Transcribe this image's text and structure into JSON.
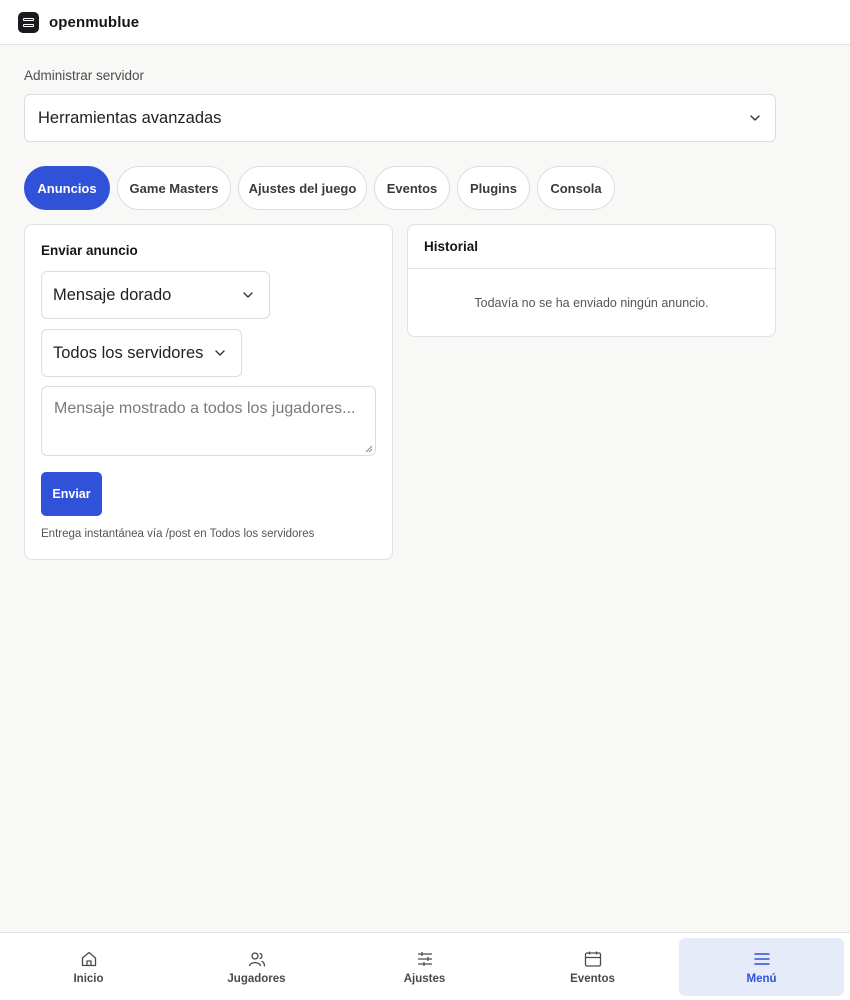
{
  "app": {
    "name": "openmublue"
  },
  "server": {
    "section_label": "Administrar servidor",
    "selected": "Herramientas avanzadas"
  },
  "tabs": [
    {
      "label": "Anuncios",
      "active": true
    },
    {
      "label": "Game Masters",
      "active": false
    },
    {
      "label": "Ajustes del juego",
      "active": false
    },
    {
      "label": "Eventos",
      "active": false
    },
    {
      "label": "Plugins",
      "active": false
    },
    {
      "label": "Consola",
      "active": false
    }
  ],
  "announce": {
    "title": "Enviar anuncio",
    "type_selected": "Mensaje dorado",
    "target_selected": "Todos los servidores",
    "message_placeholder": "Mensaje mostrado a todos los jugadores...",
    "send_label": "Enviar",
    "hint": "Entrega instantánea vía /post en Todos los servidores"
  },
  "history": {
    "title": "Historial",
    "empty": "Todavía no se ha enviado ningún anuncio."
  },
  "nav": [
    {
      "label": "Inicio",
      "icon": "home-icon",
      "active": false
    },
    {
      "label": "Jugadores",
      "icon": "users-icon",
      "active": false
    },
    {
      "label": "Ajustes",
      "icon": "sliders-icon",
      "active": false
    },
    {
      "label": "Eventos",
      "icon": "calendar-icon",
      "active": false
    },
    {
      "label": "Menú",
      "icon": "menu-icon",
      "active": true
    }
  ],
  "colors": {
    "accent": "#2f52d8",
    "nav_active_bg": "#e6ebfa",
    "background": "#f8f8f6"
  }
}
